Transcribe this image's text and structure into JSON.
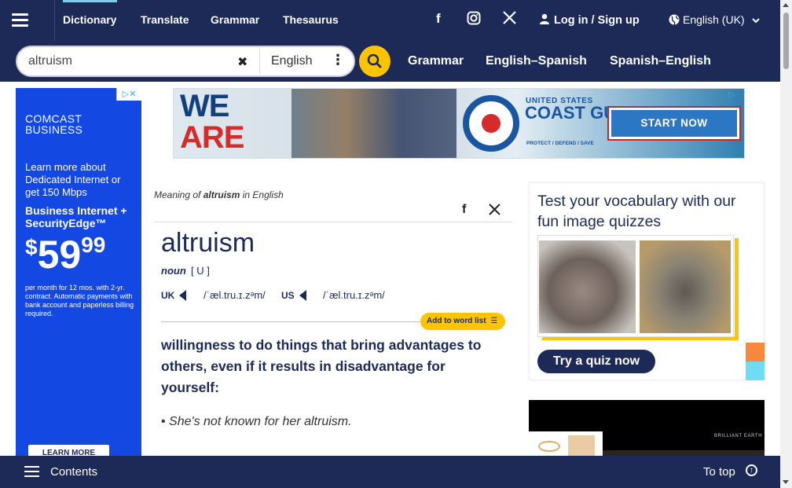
{
  "topnav": {
    "items": [
      "Dictionary",
      "Translate",
      "Grammar",
      "Thesaurus"
    ],
    "login": "Log in / Sign up",
    "language": "English (UK)",
    "social_icons": [
      "facebook-icon",
      "instagram-icon",
      "x-icon"
    ]
  },
  "search": {
    "value": "altruism",
    "dictionary": "English",
    "links": [
      "Grammar",
      "English–Spanish",
      "Spanish–English"
    ]
  },
  "ad_left": {
    "brand": "COMCAST BUSINESS",
    "lede": "Learn more about Dedicated Internet or get 150 Mbps",
    "offer": "Business Internet + SecurityEdge™",
    "price_dollar": "$",
    "price_main": "59",
    "price_cents": "99",
    "fine_print": "per month for 12 mos. with 2-yr. contract. Automatic payments with bank account and paperless billing required.",
    "cta": "LEARN MORE"
  },
  "ad_top": {
    "line1": "WE",
    "line2": "ARE",
    "us": "UNITED STATES",
    "org": "COAST GUARD",
    "tagline": "PROTECT / DEFEND / SAVE",
    "cta": "START NOW"
  },
  "entry": {
    "meta_prefix": "Meaning of ",
    "meta_word": "altruism",
    "meta_suffix": " in English",
    "headword": "altruism",
    "pos": "noun",
    "grammar": "[ U ]",
    "uk_label": "UK",
    "uk_ipa": "/ˈæl.tru.ɪ.zᵊm/",
    "us_label": "US",
    "us_ipa": "/ˈæl.tru.ɪ.zᵊm/",
    "add_to_list": "Add to word list",
    "definition": "willingness to do things that bring advantages to others, even if it results in disadvantage for yourself:",
    "example": "She's not known for her altruism."
  },
  "quiz": {
    "title": "Test your vocabulary with our fun image quizzes",
    "button": "Try a quiz now"
  },
  "video_ad": {
    "brand": "BRILLIANT EARTH"
  },
  "bottombar": {
    "contents": "Contents",
    "totop": "To top"
  }
}
